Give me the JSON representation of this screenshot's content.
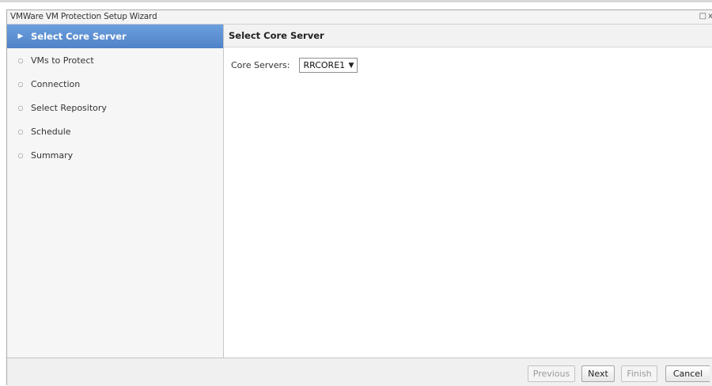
{
  "window": {
    "title": "VMWare VM Protection Setup Wizard",
    "maximize_icon": "□",
    "close_icon": "x"
  },
  "sidebar": {
    "steps": [
      {
        "label": "Select Core Server",
        "marker": "▶",
        "active": true
      },
      {
        "label": "VMs to Protect",
        "marker": "○",
        "active": false
      },
      {
        "label": "Connection",
        "marker": "○",
        "active": false
      },
      {
        "label": "Select Repository",
        "marker": "○",
        "active": false
      },
      {
        "label": "Schedule",
        "marker": "○",
        "active": false
      },
      {
        "label": "Summary",
        "marker": "○",
        "active": false
      }
    ]
  },
  "main": {
    "header": "Select Core Server",
    "core_servers_label": "Core Servers:",
    "core_servers_value": "RRCORE1",
    "dropdown_arrow": "▼"
  },
  "footer": {
    "previous_label": "Previous",
    "next_label": "Next",
    "finish_label": "Finish",
    "cancel_label": "Cancel"
  },
  "colors": {
    "active_step": "#5b8ed0",
    "sidebar_bg": "#f6f6f6"
  }
}
